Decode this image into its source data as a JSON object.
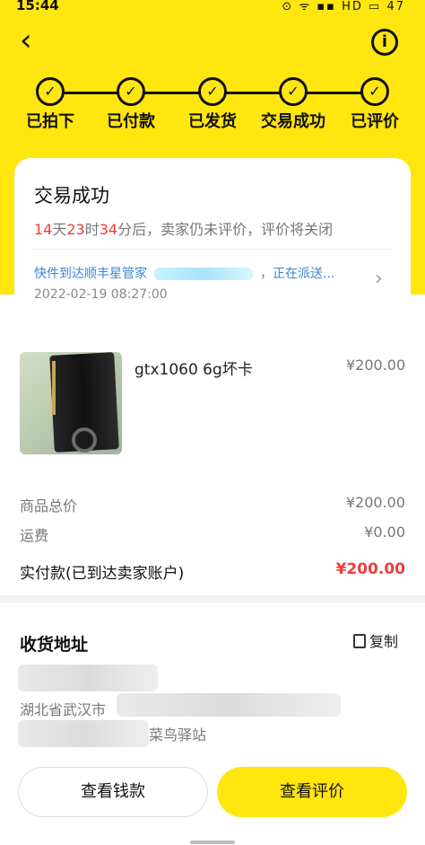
{
  "status_bar": {
    "time": "15:44",
    "icons_text": "⊙ ᯤ ▪▪ HD ▭ 47"
  },
  "nav": {
    "back_icon": "‹",
    "info_icon": "i"
  },
  "steps": [
    {
      "label": "已拍下"
    },
    {
      "label": "已付款"
    },
    {
      "label": "已发货"
    },
    {
      "label": "交易成功"
    },
    {
      "label": "已评价"
    }
  ],
  "status_card": {
    "title": "交易成功",
    "countdown": {
      "days": "14",
      "days_unit": "天",
      "hours": "23",
      "hours_unit": "时",
      "minutes": "34",
      "suffix": "分后，卖家仍未评价，评价将关闭"
    },
    "shipping_prefix": "快件到达顺丰星管家",
    "shipping_suffix": "，正在派送...",
    "shipping_time": "2022-02-19 08:27:00"
  },
  "product": {
    "name": "gtx1060 6g坏卡",
    "price": "¥200.00"
  },
  "summary": {
    "goods_total_label": "商品总价",
    "goods_total_value": "¥200.00",
    "shipping_label": "运费",
    "shipping_value": "¥0.00",
    "paid_label": "实付款(已到达卖家账户)",
    "paid_value": "¥200.00"
  },
  "address": {
    "title": "收货地址",
    "copy_label": "复制",
    "line1": "湖北省武汉市",
    "line2": "菜鸟驿站"
  },
  "actions": {
    "view_money": "查看钱款",
    "view_review": "查看评价"
  },
  "colors": {
    "brand_yellow": "#ffe60f",
    "price_red": "#f13c3c",
    "link_blue": "#3a86d8"
  }
}
